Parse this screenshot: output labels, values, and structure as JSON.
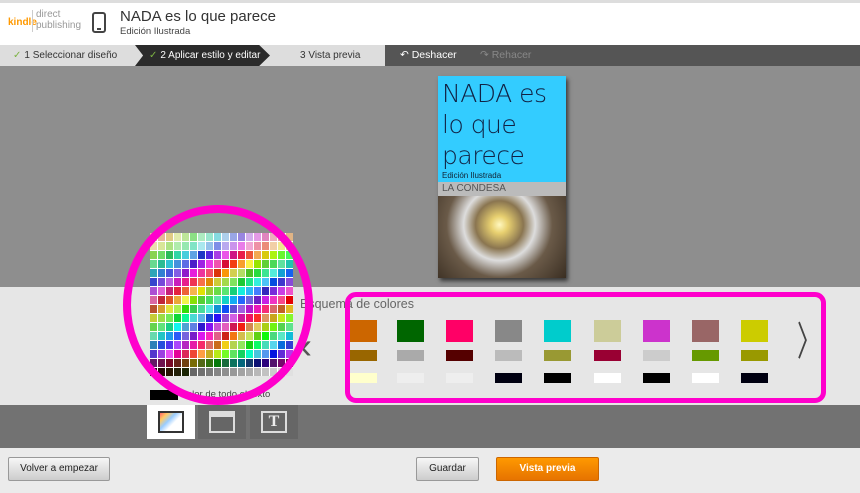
{
  "header": {
    "logo_kindle": "kindle",
    "logo_dp1": "direct",
    "logo_dp2": "publishing",
    "title": "NADA es lo que parece",
    "subtitle": "Edición Ilustrada"
  },
  "steps": [
    {
      "label": "1 Seleccionar diseño",
      "done": true
    },
    {
      "label": "2 Aplicar estilo y editar",
      "done": true,
      "active": true
    },
    {
      "label": "3 Vista previa",
      "done": false
    }
  ],
  "undo": "Deshacer",
  "redo": "Rehacer",
  "cover": {
    "title": "NADA es lo que parece",
    "edition": "Edición Ilustrada",
    "author": "LA CONDESA",
    "bg": "#33ccff"
  },
  "scheme": {
    "label": "Esquema de colores",
    "columns": [
      [
        "#cc6600",
        "#996600",
        "#ffffcc"
      ],
      [
        "#006600",
        "#aaaaaa",
        "#eeeeee"
      ],
      [
        "#ff0066",
        "#550000",
        "#eeeeee"
      ],
      [
        "#888888",
        "#bbbbbb",
        "#000011"
      ],
      [
        "#00cccc",
        "#999933",
        "#000000"
      ],
      [
        "#cccc99",
        "#990033",
        "#ffffff"
      ],
      [
        "#cc33cc",
        "#cccccc",
        "#000000"
      ],
      [
        "#996666",
        "#669900",
        "#ffffff"
      ],
      [
        "#cccc00",
        "#999900",
        "#000011"
      ]
    ]
  },
  "text_color": {
    "label": "Color de todo el texto",
    "value": "#000000"
  },
  "highlight": "#ff00cc",
  "buttons": {
    "restart": "Volver a empezar",
    "save": "Guardar",
    "preview": "Vista previa"
  },
  "tabs": [
    {
      "icon": "paint-roller-icon",
      "active": true
    },
    {
      "icon": "layout-icon"
    },
    {
      "icon": "text-icon",
      "glyph": "T"
    }
  ]
}
